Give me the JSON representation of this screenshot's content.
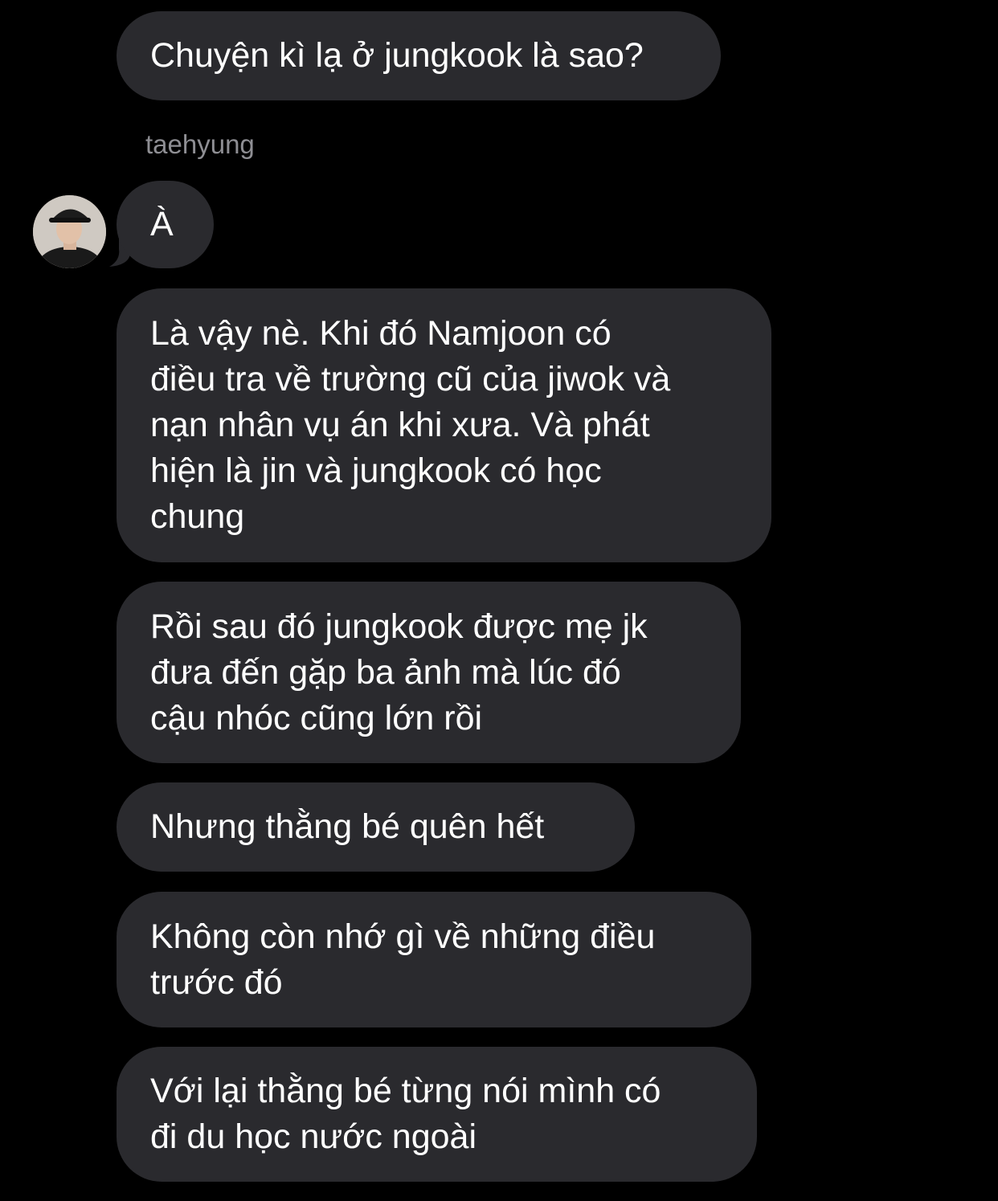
{
  "sender_name": "taehyung",
  "avatar_icon": "user-avatar-photo",
  "messages": [
    {
      "text": "Chuyện kì lạ ở jungkook là sao?"
    },
    {
      "text": "À"
    },
    {
      "text": "Là vậy nè. Khi đó Namjoon có\nđiều tra về trường cũ của jiwok và\nnạn nhân vụ án khi xưa. Và phát\nhiện là jin và jungkook có học\nchung"
    },
    {
      "text": "Rồi sau đó jungkook được mẹ jk\nđưa đến gặp ba ảnh mà lúc đó\ncậu nhóc cũng lớn rồi"
    },
    {
      "text": "Nhưng thằng bé quên hết"
    },
    {
      "text": "Không còn nhớ gì về những điều\ntrước đó"
    },
    {
      "text": "Với lại thằng bé từng nói mình có\nđi du học nước ngoài"
    }
  ],
  "colors": {
    "background": "#000000",
    "bubble": "#2a2a2e",
    "text": "#ffffff",
    "sender": "#8e8e93"
  }
}
